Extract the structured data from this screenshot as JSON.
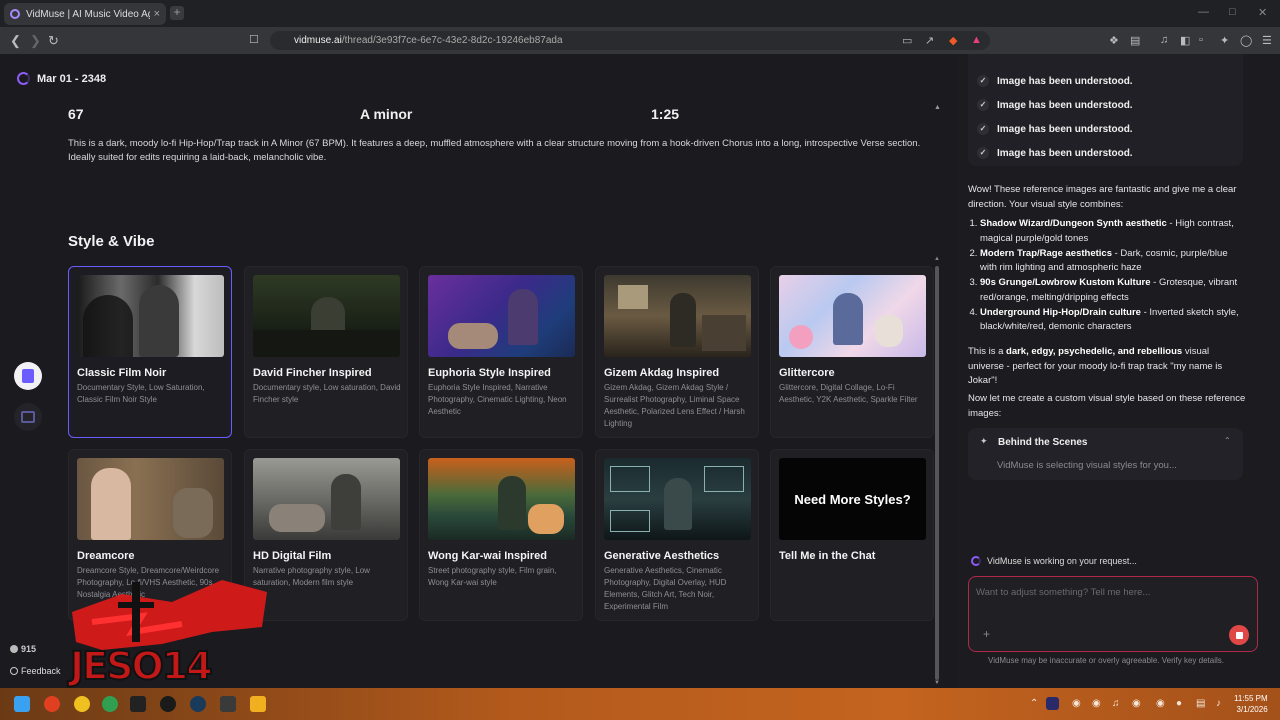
{
  "browser": {
    "tab_title": "VidMuse | AI Music Video Agent",
    "tab_close": "×",
    "new_tab": "+",
    "url_host": "vidmuse.ai",
    "url_path": "/thread/3e93f7ce-6e7c-43e2-8d2c-19246eb87ada"
  },
  "thread": {
    "title": "Mar 01 - 2348"
  },
  "track": {
    "bpm": "67",
    "key": "A minor",
    "duration": "1:25",
    "description": "This is a dark, moody lo-fi Hip-Hop/Trap track in A Minor (67 BPM). It features a deep, muffled atmosphere with a clear structure moving from a hook-driven Chorus into a long, introspective Verse section. Ideally suited for edits requiring a laid-back, melancholic vibe."
  },
  "style_section": {
    "title": "Style & Vibe",
    "cards": [
      {
        "name": "Classic Film Noir",
        "tags": "Documentary Style, Low Saturation, Classic Film Noir Style",
        "selected": true
      },
      {
        "name": "David Fincher Inspired",
        "tags": "Documentary style, Low saturation, David Fincher style"
      },
      {
        "name": "Euphoria Style Inspired",
        "tags": "Euphoria Style Inspired, Narrative Photography, Cinematic Lighting, Neon Aesthetic"
      },
      {
        "name": "Gizem Akdag Inspired",
        "tags": "Gizem Akdag, Gizem Akdag Style / Surrealist Photography, Liminal Space Aesthetic, Polarized Lens Effect / Harsh Lighting"
      },
      {
        "name": "Glittercore",
        "tags": "Glittercore, Digital Collage, Lo-Fi Aesthetic, Y2K Aesthetic, Sparkle Filter"
      },
      {
        "name": "Dreamcore",
        "tags": "Dreamcore Style, Dreamcore/Weirdcore Photography, Lo-fi/VHS Aesthetic, 90s Nostalgia Aesthetic"
      },
      {
        "name": "HD Digital Film",
        "tags": "Narrative photography style, Low saturation, Modern film style"
      },
      {
        "name": "Wong Kar-wai Inspired",
        "tags": "Street photography style, Film grain, Wong Kar-wai style"
      },
      {
        "name": "Generative Aesthetics",
        "tags": "Generative Aesthetics, Cinematic Photography, Digital Overlay, HUD Elements, Glitch Art, Tech Noir, Experimental Film"
      },
      {
        "name": "Tell Me in the Chat",
        "tags": "",
        "cta": "Need More Styles?"
      }
    ]
  },
  "sidebar": {
    "credits": "915",
    "feedback": "Feedback"
  },
  "chat": {
    "understood": [
      "Image has been understood.",
      "Image has been understood.",
      "Image has been understood.",
      "Image has been understood."
    ],
    "intro": "Wow! These reference images are fantastic and give me a clear direction. Your visual style combines:",
    "points": [
      {
        "bold": "Shadow Wizard/Dungeon Synth aesthetic",
        "text": " - High contrast, magical purple/gold tones"
      },
      {
        "bold": "Modern Trap/Rage aesthetics",
        "text": " - Dark, cosmic, purple/blue with rim lighting and atmospheric haze"
      },
      {
        "bold": "90s Grunge/Lowbrow Kustom Kulture",
        "text": " - Grotesque, vibrant red/orange, melting/dripping effects"
      },
      {
        "bold": "Underground Hip-Hop/Drain culture",
        "text": " - Inverted sketch style, black/white/red, demonic characters"
      }
    ],
    "summary_pre": "This is a ",
    "summary_bold": "dark, edgy, psychedelic, and rebellious",
    "summary_post": " visual universe - perfect for your moody lo-fi trap track \"my name is Jokar\"!",
    "next": "Now let me create a custom visual style based on these reference images:",
    "behind_title": "Behind the Scenes",
    "behind_status": "VidMuse is selecting visual styles for you...",
    "working": "VidMuse is working on your request...",
    "input_placeholder": "Want to adjust something? Tell me here...",
    "disclaimer": "VidMuse may be inaccurate or overly agreeable. Verify key details."
  },
  "taskbar": {
    "time": "11:55 PM",
    "date": "3/1/2026",
    "overlay_text": "JESO14"
  },
  "colors": {
    "accent": "#6a5cff",
    "stop": "#e04848",
    "input_border": "#b0284a"
  }
}
